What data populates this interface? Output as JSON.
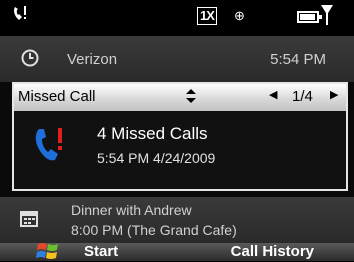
{
  "status_bar": {
    "network_label": "1X",
    "icons": [
      "missed-call-icon",
      "network-1x-icon",
      "roaming-icon",
      "battery-icon",
      "signal-icon"
    ]
  },
  "owner_row": {
    "carrier": "Verizon",
    "time": "5:54 PM",
    "icon": "clock-icon"
  },
  "notification": {
    "title": "Missed Call",
    "pager": "1/4",
    "count_text": "4 Missed Calls",
    "timestamp": "5:54 PM 4/24/2009",
    "icon": "missed-call-phone-icon",
    "accent": "#1e6fd9",
    "alert": "#e02020"
  },
  "calendar_row": {
    "line1": "Dinner with Andrew",
    "line2": "8:00 PM (The Grand Cafe)",
    "icon": "calendar-icon"
  },
  "softkeys": {
    "left": "Start",
    "right": "Call History",
    "logo": "windows-logo-icon"
  }
}
